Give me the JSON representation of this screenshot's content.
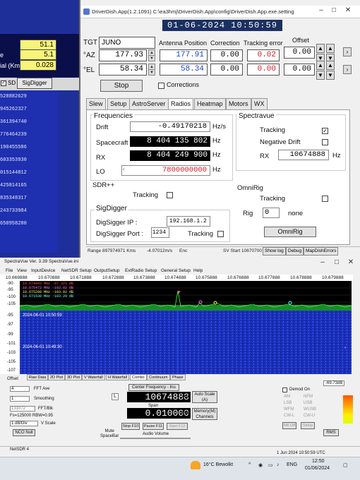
{
  "left": {
    "fields": [
      {
        "label": "",
        "value": "51.1"
      },
      {
        "label": "e",
        "value": "5.1"
      },
      {
        "label": "ial (Km)",
        "value": "0.028"
      }
    ],
    "sd_label": "SD",
    "sd_checked": "✓",
    "sigdigger_label": "SigDigger",
    "list": [
      "528882629",
      "945262327",
      "361394740",
      "776464239",
      "190455586",
      "603353930",
      "015144812",
      "425814165",
      "835348317",
      "243733984",
      "650958280"
    ]
  },
  "driverdish": {
    "title": "DriverDish.App(1.2.1091) C:\\ea3hmj\\DriverDish.App\\config\\DriverDish.App.exe.setting",
    "datetime": "01-06-2024 10:50:59",
    "tgt_label": "TGT",
    "tgt_value": "JUNO",
    "headers": {
      "antenna": "Antenna Position",
      "correction": "Correction",
      "tracking_error": "Tracking error",
      "offset": "Offset"
    },
    "az": {
      "label": "°AZ",
      "target": "177.93",
      "antenna": "177.91",
      "correction": "0.00",
      "tracking_error": "0.02",
      "offset": "0.00"
    },
    "el": {
      "label": "°EL",
      "target": "58.34",
      "antenna": "58.34",
      "correction": "0.00",
      "tracking_error": "0.00",
      "offset": "0.00"
    },
    "stop_label": "Stop",
    "corrections_label": "Corrections",
    "tabs": [
      "Slew",
      "Setup",
      "AstroServer",
      "Radios",
      "Heatmap",
      "Motors",
      "WX"
    ],
    "active_tab": "Radios",
    "frequencies": {
      "title": "Frequencies",
      "drift_label": "Drift",
      "drift_value": "-0.49170218",
      "drift_unit": "Hz/s",
      "spacecraft_label": "Spacecraft",
      "spacecraft_value": "8 404 135 802",
      "spacecraft_unit": "Hz",
      "rx_label": "RX",
      "rx_value": "8 404 249 900",
      "rx_unit": "Hz",
      "lo_label": "LO",
      "lo_value": "7800000000",
      "lo_unit": "Hz"
    },
    "spectravue_group": {
      "title": "Spectravue",
      "tracking_label": "Tracking",
      "tracking_checked": "✓",
      "negative_drift_label": "Negative Drift",
      "rx_label": "RX",
      "rx_value": "10674888",
      "rx_unit": "Hz"
    },
    "sdrpp": {
      "title": "SDR++",
      "tracking_label": "Tracking"
    },
    "omnirig": {
      "title": "OmniRig",
      "tracking_label": "Tracking",
      "rig_label": "Rig",
      "rig_value": "0",
      "rig_name": "none",
      "button": "OmniRig"
    },
    "sigdigger": {
      "title": "SigDigger",
      "ip_label": "DigSigger IP :",
      "ip_value": "192.168.1.2",
      "port_label": "DigSigger Port :",
      "port_value": "1234",
      "tracking_label": "Tracking"
    },
    "status": {
      "range": "Range 897974971 Kms",
      "rate": "-4.07012m/s",
      "enc": "Enc",
      "sv_start": "SV Start 10670700",
      "show_log": "Show log",
      "debug": "Debug",
      "map_errors": "MapDishErrors"
    }
  },
  "spectravue": {
    "title": "SpectraVue Ver. 3.39  SpectraVue.ini",
    "menu": [
      "File",
      "View",
      "InputDevice",
      "NetSDR Setup",
      "OutputSetup",
      "ExtRadio Setup",
      "General Setup",
      "Help"
    ],
    "freq_ticks": [
      "10.669888",
      "10.670888",
      "10.671888",
      "10.672888",
      "10.673888",
      "10.674888",
      "10.675888",
      "10.676888",
      "10.677888",
      "10.678888",
      "10.679888"
    ],
    "y_ticks": [
      "-90",
      "-95",
      "-100",
      "-105",
      "-95",
      "-97",
      "-99",
      "-101",
      "-103",
      "-105",
      "-107"
    ],
    "legend": [
      {
        "text": "10.674943 MHz  -97.321 dB",
        "color": "#ff5555"
      },
      {
        "text": "10.675472 MHz  -103.02 dB",
        "color": "#ff66ff"
      },
      {
        "text": "10.675288 MHz  -103.02 dB",
        "color": "#ffff55"
      },
      {
        "text": "10.671530 MHz  -103.20 dB",
        "color": "#66ffff"
      }
    ],
    "wf_times": [
      "2024-06-01 10:50:59",
      "2024-06-01 10:49:30"
    ],
    "controls": {
      "offset": "Offset",
      "fft_ave": "FFT Ave",
      "fft_ave_val": "4",
      "smoothing": "Smoothing",
      "smoothing_val": "1",
      "fftblk": "FFT/Blk",
      "fftblk_val": "131072",
      "fs": "Fs=125000 RBW=0.95",
      "vscale": "V Scale",
      "vscale_val": "1 dB/Div",
      "ncd_null": "NCO Null",
      "center_label": "Center Frequency - Inu",
      "center_value": "10674888",
      "center_unit": "MHz",
      "span_label": "Span",
      "span_value": "0.010000",
      "span_unit": "MHz",
      "autoscale": "Auto Scale",
      "autoscale_a": "(A)",
      "memory": "Memory(M)",
      "channels": "Channels",
      "mute": "Mute",
      "spacebar": "SpaceBar",
      "stop": "Stop F10",
      "pause": "Pause F11",
      "start": "Start F12",
      "volume": "Audio Volume",
      "demod": "Demod On",
      "am": "AM",
      "nfm": "NFM",
      "lsb": "LSB",
      "usb": "USB",
      "wfm": "WFM",
      "cwl": "CW-L",
      "wusb": "WUSB",
      "cwu": "CW-U",
      "nb_off": "NB Off",
      "setup": "Setup",
      "db": "-69.73dB",
      "rms": "RMS"
    },
    "tabs": [
      "Raw Data",
      "2D Plot",
      "3D Plot",
      "V Waterfall",
      "H Waterfall",
      "Combo",
      "Continuum",
      "Phase"
    ],
    "status_left": "NetSDR 4",
    "status_right": "1 Jun 2024  10:50:59 UTC"
  },
  "taskbar": {
    "weather": "16°C  Bewolkt",
    "lang": "ENG",
    "time": "12:50",
    "date": "01/06/2024"
  }
}
